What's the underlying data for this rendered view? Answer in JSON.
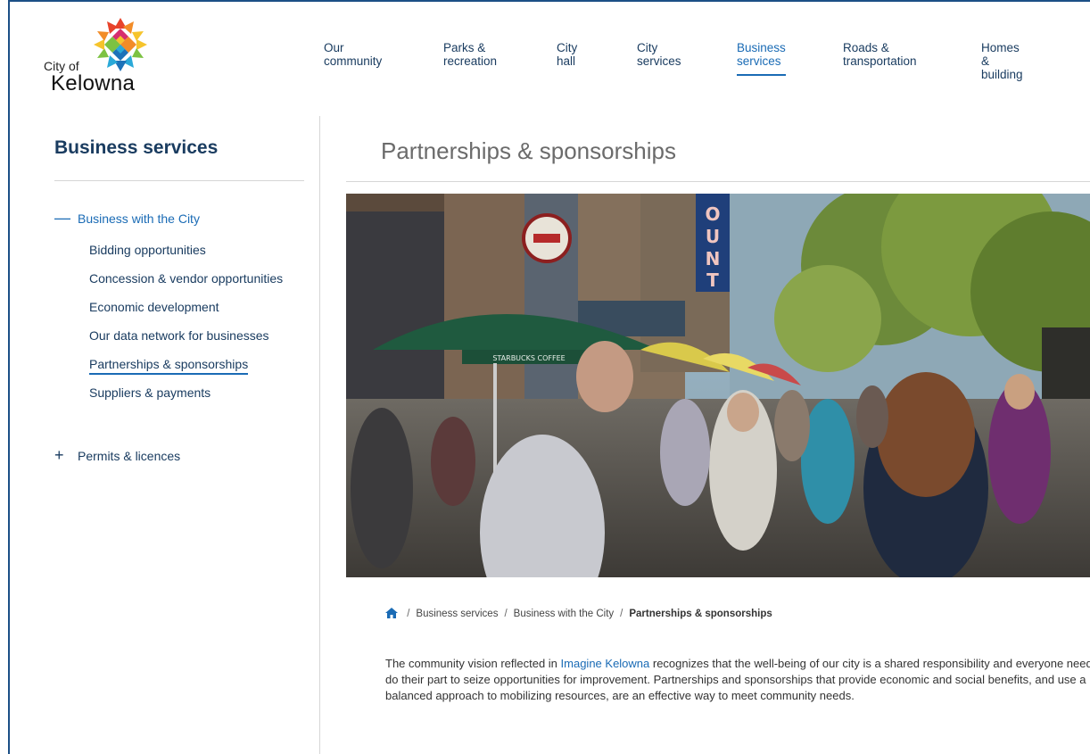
{
  "logo": {
    "city_of": "City of",
    "name": "Kelowna"
  },
  "nav": [
    {
      "label": "Our\ncommunity",
      "active": false
    },
    {
      "label": "Parks &\nrecreation",
      "active": false
    },
    {
      "label": "City\nhall",
      "active": false
    },
    {
      "label": "City\nservices",
      "active": false
    },
    {
      "label": "Business\nservices",
      "active": true
    },
    {
      "label": "Roads &\ntransportation",
      "active": false
    },
    {
      "label": "Homes &\nbuilding",
      "active": false
    }
  ],
  "sidebar": {
    "title": "Business services",
    "expanded_section": {
      "symbol": "—",
      "label": "Business with the City"
    },
    "items": [
      "Bidding opportunities",
      "Concession & vendor opportunities",
      "Economic development",
      "Our data network for businesses",
      "Partnerships & sponsorships",
      "Suppliers & payments"
    ],
    "current_item": "Partnerships & sponsorships",
    "collapsed_section": {
      "symbol": "+",
      "label": "Permits & licences"
    }
  },
  "main": {
    "title": "Partnerships & sponsorships",
    "hero_sign_letters": [
      "O",
      "U",
      "N",
      "T"
    ],
    "umbrella_text": "STARBUCKS COFFEE",
    "breadcrumb": [
      "Business services",
      "Business with the City",
      "Partnerships & sponsorships"
    ],
    "body": {
      "before_link": "The community vision reflected in ",
      "link": "Imagine Kelowna",
      "after_link": " recognizes that the well-being of our city is a shared responsibility and everyone needs to do their part to seize opportunities for improvement. Partnerships and sponsorships that provide economic and social benefits, and use a balanced approach to mobilizing resources, are an effective way to meet community needs."
    }
  },
  "colors": {
    "brand_navy": "#1a3c60",
    "link_blue": "#1a6bb5",
    "frame_blue": "#1c4f86"
  }
}
